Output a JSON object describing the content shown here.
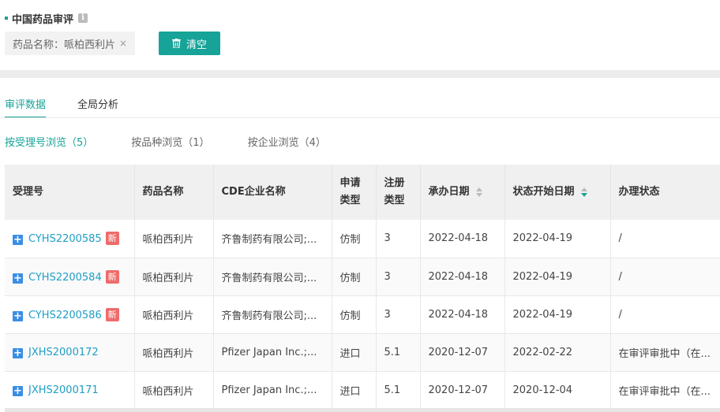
{
  "header": {
    "title": "中国药品审评",
    "info_icon": "i"
  },
  "filter": {
    "tag_label": "药品名称：哌柏西利片",
    "tag_close": "×",
    "clear_label": "清空"
  },
  "tabs": [
    {
      "label": "审评数据",
      "active": true
    },
    {
      "label": "全局分析",
      "active": false
    }
  ],
  "subtabs": [
    {
      "label": "按受理号浏览（5）",
      "active": true
    },
    {
      "label": "按品种浏览（1）",
      "active": false
    },
    {
      "label": "按企业浏览（4）",
      "active": false
    }
  ],
  "table": {
    "columns": [
      "受理号",
      "药品名称",
      "CDE企业名称",
      "申请类型",
      "注册类型",
      "承办日期",
      "状态开始日期",
      "办理状态"
    ],
    "col_apply_type_line1": "申请",
    "col_apply_type_line2": "类型",
    "col_reg_type_line1": "注册",
    "col_reg_type_line2": "类型",
    "new_badge": "新",
    "rows": [
      {
        "acc": "CYHS2200585",
        "new": true,
        "drug": "哌柏西利片",
        "company": "齐鲁制药有限公司;...",
        "apply": "仿制",
        "reg": "3",
        "date1": "2022-04-18",
        "date2": "2022-04-19",
        "status": "/"
      },
      {
        "acc": "CYHS2200584",
        "new": true,
        "drug": "哌柏西利片",
        "company": "齐鲁制药有限公司;...",
        "apply": "仿制",
        "reg": "3",
        "date1": "2022-04-18",
        "date2": "2022-04-19",
        "status": "/"
      },
      {
        "acc": "CYHS2200586",
        "new": true,
        "drug": "哌柏西利片",
        "company": "齐鲁制药有限公司;...",
        "apply": "仿制",
        "reg": "3",
        "date1": "2022-04-18",
        "date2": "2022-04-19",
        "status": "/"
      },
      {
        "acc": "JXHS2000172",
        "new": false,
        "drug": "哌柏西利片",
        "company": "Pfizer Japan Inc.;...",
        "apply": "进口",
        "reg": "5.1",
        "date1": "2020-12-07",
        "date2": "2022-02-22",
        "status": "在审评审批中（在..."
      },
      {
        "acc": "JXHS2000171",
        "new": false,
        "drug": "哌柏西利片",
        "company": "Pfizer Japan Inc.;...",
        "apply": "进口",
        "reg": "5.1",
        "date1": "2020-12-07",
        "date2": "2020-12-04",
        "status": "在审评审批中（在..."
      }
    ]
  },
  "colors": {
    "accent": "#17a398",
    "link": "#1f9ec5",
    "badge": "#ef6b6b",
    "expand": "#3a8ee6"
  },
  "icons": [
    "info-icon",
    "close-icon",
    "trash-icon",
    "sort-icon",
    "expand-plus-icon"
  ]
}
